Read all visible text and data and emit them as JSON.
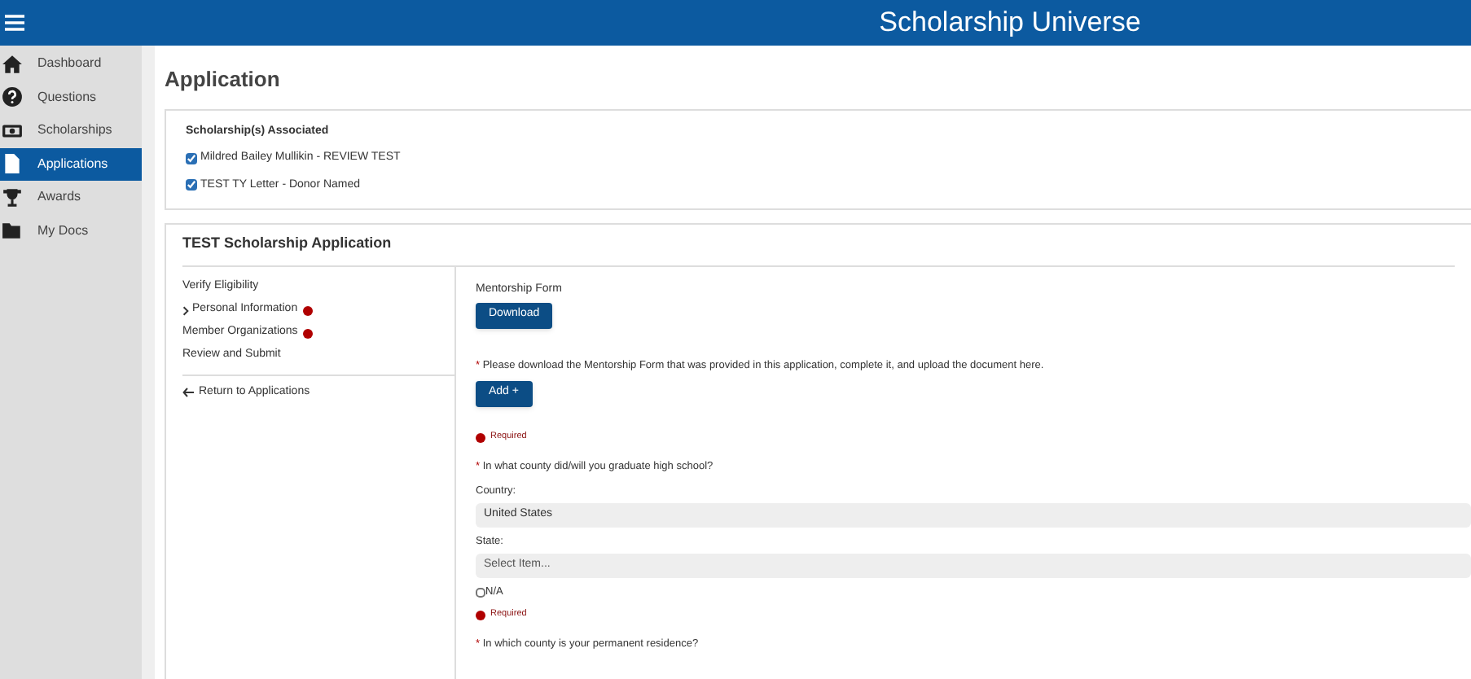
{
  "header": {
    "title": "Scholarship Universe"
  },
  "sidebar": {
    "items": [
      {
        "label": "Dashboard",
        "selected": false
      },
      {
        "label": "Questions",
        "selected": false
      },
      {
        "label": "Scholarships",
        "selected": false
      },
      {
        "label": "Applications",
        "selected": true
      },
      {
        "label": "Awards",
        "selected": false
      },
      {
        "label": "My Docs",
        "selected": false
      }
    ]
  },
  "page_title": "Application",
  "associated": {
    "heading": "Scholarship(s) Associated",
    "items": [
      {
        "label": "Mildred Bailey Mullikin - REVIEW TEST",
        "checked": true
      },
      {
        "label": "TEST TY Letter - Donor Named",
        "checked": true
      }
    ]
  },
  "application": {
    "title": "TEST Scholarship Application",
    "steps": [
      {
        "label": "Verify Eligibility",
        "current": false,
        "error": false
      },
      {
        "label": "Personal Information",
        "current": true,
        "error": true
      },
      {
        "label": "Member Organizations",
        "current": false,
        "error": true
      },
      {
        "label": "Review and Submit",
        "current": false,
        "error": false
      }
    ],
    "return_link": "Return to Applications",
    "form": [
      {
        "kind": "label",
        "text": "Mentorship Form"
      },
      {
        "kind": "button",
        "label": "Download"
      },
      {
        "kind": "question",
        "marker": "*",
        "text": "Please download the Mentorship Form that was provided in this application, complete it, and upload the document here."
      },
      {
        "kind": "button",
        "label": "Add +"
      },
      {
        "kind": "error",
        "text": "Required"
      },
      {
        "kind": "question",
        "marker": "*",
        "text": "In what county did/will you graduate high school?"
      },
      {
        "kind": "field_label",
        "text": "Country:"
      },
      {
        "kind": "select",
        "value": "United States"
      },
      {
        "kind": "field_label",
        "text": "State:"
      },
      {
        "kind": "select",
        "placeholder": "Select Item..."
      },
      {
        "kind": "checkbox",
        "label": "N/A",
        "checked": false
      },
      {
        "kind": "error",
        "text": "Required"
      },
      {
        "kind": "question",
        "marker": "*",
        "text": "In which county is your permanent residence?"
      }
    ]
  }
}
